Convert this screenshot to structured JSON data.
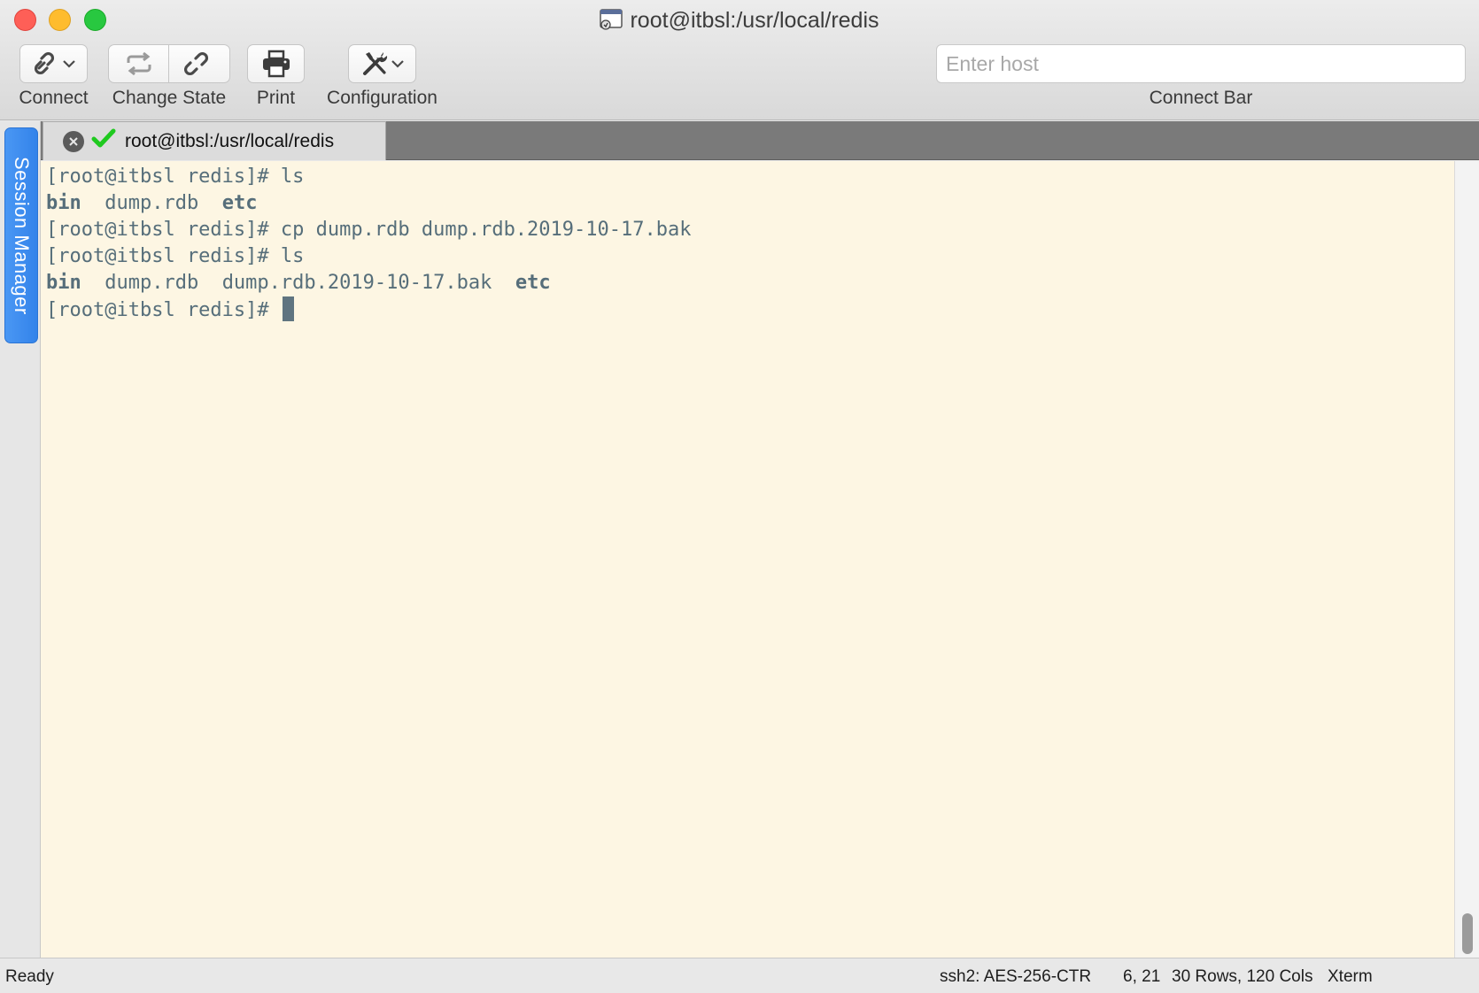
{
  "window": {
    "title": "root@itbsl:/usr/local/redis"
  },
  "toolbar": {
    "connect_label": "Connect",
    "change_state_label": "Change State",
    "print_label": "Print",
    "configuration_label": "Configuration",
    "host_placeholder": "Enter host",
    "connect_bar_label": "Connect Bar"
  },
  "sidebar": {
    "session_manager_label": "Session Manager"
  },
  "tab": {
    "label": "root@itbsl:/usr/local/redis"
  },
  "terminal": {
    "lines": [
      {
        "prompt": "[root@itbsl redis]# ",
        "command": "ls"
      },
      {
        "output": [
          {
            "text": "bin",
            "bold": true
          },
          {
            "text": "  dump.rdb  ",
            "bold": false
          },
          {
            "text": "etc",
            "bold": true
          }
        ]
      },
      {
        "prompt": "[root@itbsl redis]# ",
        "command": "cp dump.rdb dump.rdb.2019-10-17.bak"
      },
      {
        "prompt": "[root@itbsl redis]# ",
        "command": "ls"
      },
      {
        "output": [
          {
            "text": "bin",
            "bold": true
          },
          {
            "text": "  dump.rdb  dump.rdb.2019-10-17.bak  ",
            "bold": false
          },
          {
            "text": "etc",
            "bold": true
          }
        ]
      },
      {
        "prompt": "[root@itbsl redis]# ",
        "command": ""
      }
    ]
  },
  "status": {
    "state": "Ready",
    "cipher": "ssh2: AES-256-CTR",
    "cursor_pos": "6, 21",
    "dimensions": "30 Rows, 120 Cols",
    "terminal_type": "Xterm"
  },
  "colors": {
    "terminal_bg": "#fdf6e3",
    "terminal_fg": "#566e7a",
    "session_tab": "#3a8cf0",
    "connected_check": "#1fc91f"
  }
}
